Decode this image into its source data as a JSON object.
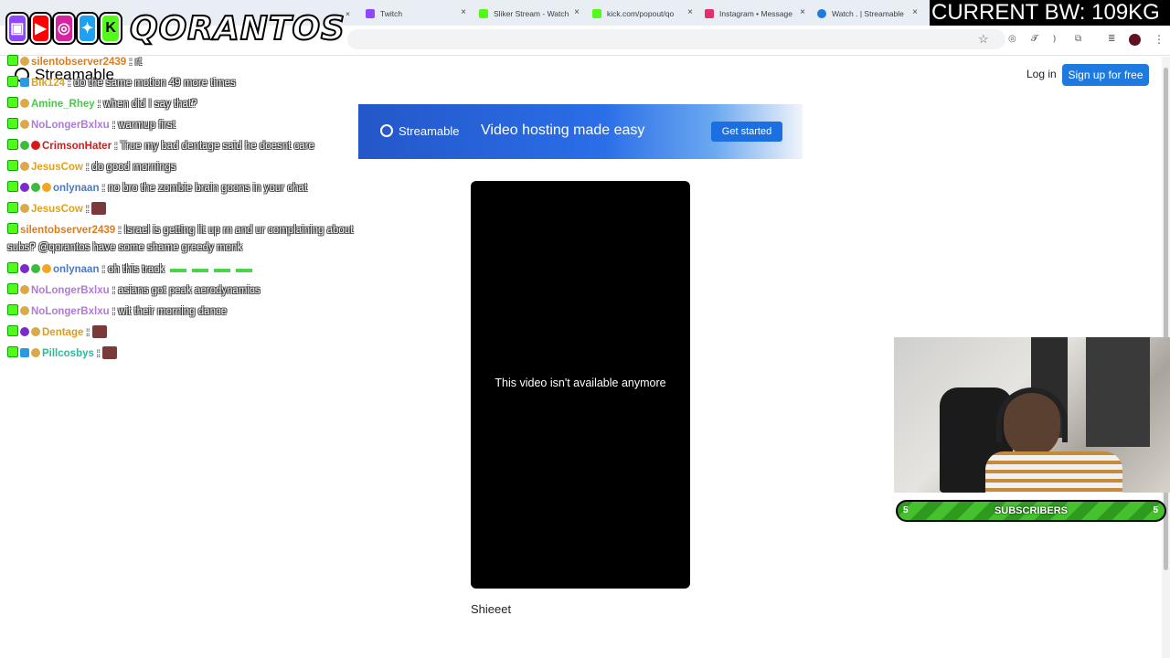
{
  "browser": {
    "tabs": [
      {
        "label": "Twitch",
        "color": "#9146ff"
      },
      {
        "label": "Sliker Stream - Watch",
        "color": "#53fc18"
      },
      {
        "label": "kick.com/popout/qo",
        "color": "#53fc18"
      },
      {
        "label": "Instagram • Message",
        "color": "#e1306c"
      },
      {
        "label": "Watch . | Streamable",
        "color": "#1f7ae0"
      }
    ],
    "close_glyph": "×",
    "star_icon": "☆",
    "ext_icons": [
      "◎",
      "𝓣",
      "⦆",
      "⧉",
      "≣"
    ],
    "menu_icon": "⋮"
  },
  "overlay": {
    "brand": "QORANTOS",
    "bw_label": "CURRENT BW: 109KG",
    "social_icons": [
      "twitch-icon",
      "youtube-icon",
      "instagram-icon",
      "twitter-icon",
      "kick-icon"
    ]
  },
  "streamable": {
    "logo": "Streamable",
    "login": "Log in",
    "signup": "Sign up for free",
    "banner": {
      "brand": "Streamable",
      "tagline": "Video hosting made easy",
      "cta": "Get started"
    },
    "video": {
      "message": "This video isn't available anymore",
      "title": "Shieeet"
    }
  },
  "chat": [
    {
      "user": "silentobserver2439",
      "color": "#e07b1a",
      "text": "rt",
      "badges": [
        "k",
        "ban"
      ]
    },
    {
      "user": "Blk124",
      "color": "#e0a21a",
      "text": "do the same motion 49 more times",
      "badges": [
        "k",
        "blue"
      ]
    },
    {
      "user": "Amine_Rhey",
      "color": "#3fcf3f",
      "text": "when did I say that?",
      "badges": [
        "k",
        "ban"
      ]
    },
    {
      "user": "NoLongerBxlxu",
      "color": "#b07ad8",
      "text": "warmup first",
      "badges": [
        "k",
        "ban"
      ]
    },
    {
      "user": "CrimsonHater",
      "color": "#d41a1a",
      "text": "True my bad dentage said he doesnt care",
      "badges": [
        "k",
        "green",
        "red"
      ]
    },
    {
      "user": "JesusCow",
      "color": "#e0a21a",
      "text": "do good mornings",
      "badges": [
        "k",
        "ban"
      ]
    },
    {
      "user": "onlynaan",
      "color": "#4a78c8",
      "text": "no bro the zombie brain goons in your chat",
      "badges": [
        "k",
        "purple",
        "green",
        "orange"
      ]
    },
    {
      "user": "JesusCow",
      "color": "#e0a21a",
      "text": "",
      "badges": [
        "k",
        "ban"
      ],
      "emote": true
    },
    {
      "user": "silentobserver2439",
      "color": "#e07b1a",
      "text": "Israel is getting lit up rn and ur complaining about",
      "text2": "subs? @qorantos have some shame greedy monk",
      "badges": [
        "k"
      ]
    },
    {
      "user": "onlynaan",
      "color": "#4a78c8",
      "text": "oh this track",
      "badges": [
        "k",
        "purple",
        "green",
        "orange"
      ],
      "green_emotes": 4
    },
    {
      "user": "NoLongerBxlxu",
      "color": "#b07ad8",
      "text": "asians got peak aerodynamics",
      "badges": [
        "k",
        "ban"
      ]
    },
    {
      "user": "NoLongerBxlxu",
      "color": "#b07ad8",
      "text": "wit their morning dance",
      "badges": [
        "k",
        "ban"
      ]
    },
    {
      "user": "Dentage",
      "color": "#e09a1a",
      "text": "",
      "badges": [
        "k",
        "purple",
        "ban"
      ],
      "emote": true
    },
    {
      "user": "Pillcosbys",
      "color": "#2fb89a",
      "text": "",
      "badges": [
        "k",
        "blue",
        "ban"
      ],
      "emote": true
    }
  ],
  "webcam": {
    "subs_left": "5",
    "subs_label": "SUBSCRIBERS",
    "subs_right": "5"
  }
}
